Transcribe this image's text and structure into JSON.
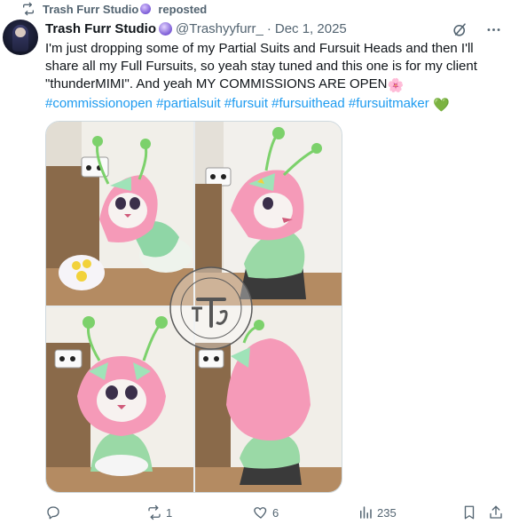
{
  "repost_header": {
    "name": "Trash Furr Studio",
    "suffix": "reposted"
  },
  "post": {
    "display_name": "Trash Furr Studio",
    "handle": "@Trashyyfurr_",
    "separator": "·",
    "date": "Dec 1, 2025",
    "text_lines": [
      "I'm just dropping some of my Partial Suits and Fursuit Heads and then I'll",
      "share all my Full Fursuits, so yeah stay tuned and this one is for my client",
      "\"thunderMIMI\". And yeah MY COMMISSIONS ARE OPEN"
    ],
    "hashtags": [
      "#commissionopen",
      "#partialsuit",
      "#fursuit",
      "#fursuithead",
      "#fursuitmaker"
    ],
    "emoji_flower": "🌸",
    "emoji_heart": "💚",
    "watermark_text": "TRASH FURR STUDIO"
  },
  "actions": {
    "replies": "",
    "reposts": "1",
    "likes": "6",
    "views": "235"
  },
  "colors": {
    "accent": "#1d9bf0",
    "muted": "#536471",
    "text": "#0f1419"
  }
}
